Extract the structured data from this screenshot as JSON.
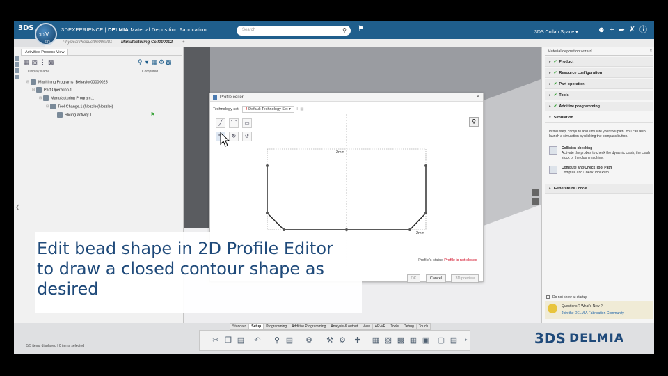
{
  "topbar": {
    "logo": "3DS",
    "compass": {
      "left": "3D",
      "center": "V",
      "bottom": "6.R"
    },
    "brand": "3DEXPERIENCE",
    "separator": " | ",
    "product": "DELMIA",
    "app": "Material Deposition Fabrication",
    "search_placeholder": "Search",
    "search_icon": "magnifier-icon",
    "space": "3DS Collab Space",
    "icons": [
      "user-icon",
      "plus-icon",
      "share-icon",
      "tools-icon",
      "help-icon"
    ]
  },
  "tabs": [
    {
      "label": "Physical Product00000281",
      "active": false
    },
    {
      "label": "Manufacturing Cell000002",
      "active": true
    },
    {
      "label": "+",
      "active": false
    }
  ],
  "left_panel": {
    "title": "Activities Process View",
    "columns": [
      "Display Name",
      "Computed"
    ],
    "tree": [
      {
        "label": "Machining Programs_Behavior00000025",
        "level": 0
      },
      {
        "label": "Part Operation.1",
        "level": 1
      },
      {
        "label": "Manufacturing Program.1",
        "level": 2
      },
      {
        "label": "Tool Change.1 (Nozzle (Nozzle))",
        "level": 3
      },
      {
        "label": "Slicing activity.1",
        "level": 4
      }
    ],
    "status": "5/5 items displayed | 0 items selected"
  },
  "profile_editor": {
    "title": "Profile editor",
    "close": "×",
    "technology_label": "Technology set",
    "technology_value": "Default Technology Set",
    "technology_warning": "!",
    "dim_top": "2mm",
    "dim_bottom": "2mm",
    "status_label": "Profile's status",
    "status_value": "Profile is not closed",
    "buttons": {
      "ok": "OK",
      "cancel": "Cancel",
      "preview": "3D preview"
    }
  },
  "caption": {
    "line1": "Edit bead shape in 2D Profile Editor",
    "line2": "to draw a closed contour shape as",
    "line3": "desired"
  },
  "wizard": {
    "title": "Material deposition wizard",
    "close": "×",
    "steps": [
      {
        "label": "Product",
        "done": true
      },
      {
        "label": "Resource configuration",
        "done": true
      },
      {
        "label": "Part operation",
        "done": true
      },
      {
        "label": "Tools",
        "done": true
      },
      {
        "label": "Additive programming",
        "done": true
      },
      {
        "label": "Simulation",
        "done": false
      }
    ],
    "simulation_text": "In this step, compute and simulate your tool path. You can also launch a simulation by clicking the compass button.",
    "collision_title": "Collision checking",
    "collision_desc": "Activate the probes to check the dynamic clash, the clash stock or the clash machine.",
    "compute_title": "Compute and Check Tool Path",
    "compute_desc": "Compute and Check Tool Path",
    "generate": "Generate NC code",
    "startup_label": "Do not show at startup",
    "questions": "Questions ? What's New ?",
    "community_link": "Join the DELMIA Fabrication Community"
  },
  "actionbar": {
    "tabs": [
      "Standard",
      "Setup",
      "Programming",
      "Additive Programming",
      "Analysis & output",
      "View",
      "AR-VR",
      "Tools",
      "Debug",
      "Touch"
    ],
    "active_tab": "Setup"
  },
  "footer_logo": {
    "mark": "3DS",
    "name": "DELMIA"
  }
}
